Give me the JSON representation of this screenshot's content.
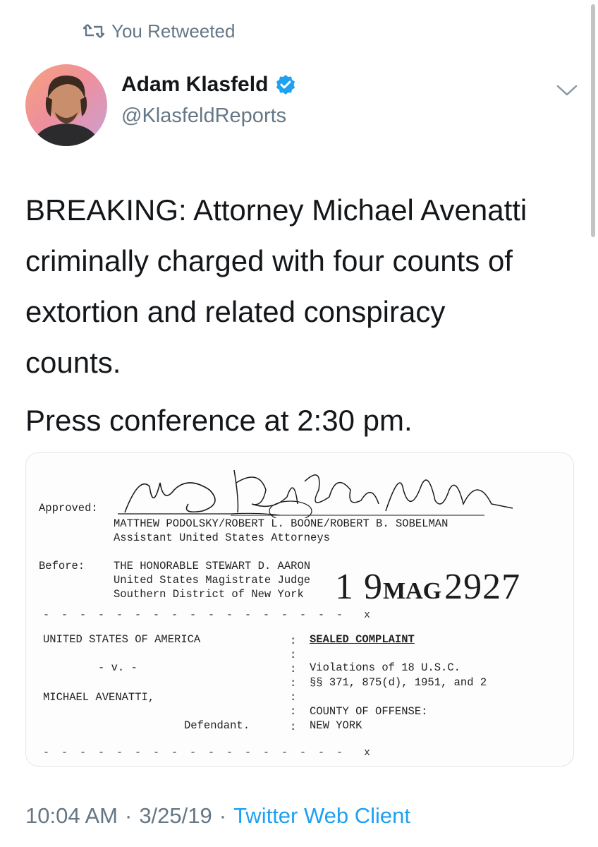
{
  "retweet": {
    "label": "You Retweeted"
  },
  "author": {
    "name": "Adam Klasfeld",
    "handle": "@KlasfeldReports"
  },
  "tweet": {
    "lines": [
      "BREAKING: Attorney Michael Avenatti",
      "criminally charged with four counts of",
      "extortion and related conspiracy",
      "counts."
    ],
    "line2": "Press conference at 2:30 pm."
  },
  "document": {
    "approved_label": "Approved:",
    "approved_names": "MATTHEW PODOLSKY/ROBERT L. BOONE/ROBERT B. SOBELMAN",
    "approved_title": "Assistant United States Attorneys",
    "before_label": "Before:",
    "judge_line1": "THE HONORABLE STEWART D. AARON",
    "judge_line2": "United States Magistrate Judge",
    "judge_line3": "Southern District of New York",
    "stamp_num1": "1 9",
    "stamp_mid": "MAG",
    "stamp_num2": "2927",
    "dashes_top": "- - - - - - - - - - - - - - - - -  x",
    "dashes_bottom": "- - - - - - - - - - - - - - - - -  x",
    "plaintiff": "UNITED STATES OF AMERICA",
    "versus": "- v. -",
    "defendant_name": "MICHAEL AVENATTI,",
    "defendant_label": "Defendant.",
    "complaint_title": "SEALED COMPLAINT",
    "violations_1": "Violations of 18 U.S.C.",
    "violations_2": "§§ 371, 875(d), 1951, and 2",
    "county_label": "COUNTY OF OFFENSE:",
    "county_value": "NEW YORK",
    "colon": ":"
  },
  "footer": {
    "time": "10:04 AM",
    "dot1": "·",
    "date": "3/25/19",
    "dot2": "·",
    "client": "Twitter Web Client"
  },
  "colors": {
    "accent": "#1da1f2",
    "secondary_text": "#657786",
    "primary_text": "#14171a"
  },
  "icons": {
    "retweet": "retweet-icon",
    "verified": "verified-badge-icon",
    "caret": "chevron-down-icon"
  }
}
